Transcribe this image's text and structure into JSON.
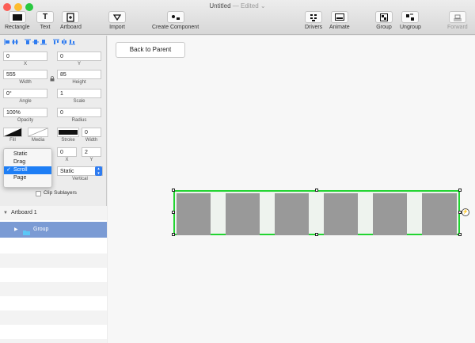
{
  "window": {
    "title": "Untitled",
    "edited": " — Edited ⌄"
  },
  "toolbar": {
    "rectangle": "Rectangle",
    "text": "Text",
    "artboard": "Artboard",
    "import": "Import",
    "create_component": "Create Component",
    "drivers": "Drivers",
    "animate": "Animate",
    "group": "Group",
    "ungroup": "Ungroup",
    "forward": "Forward",
    "text_icon_glyph": "T"
  },
  "inspector": {
    "x": {
      "value": "0",
      "label": "X"
    },
    "y": {
      "value": "0",
      "label": "Y"
    },
    "width": {
      "value": "555",
      "label": "Width"
    },
    "height": {
      "value": "85",
      "label": "Height"
    },
    "angle": {
      "value": "0°",
      "label": "Angle"
    },
    "scale": {
      "value": "1",
      "label": "Scale"
    },
    "opacity": {
      "value": "100%",
      "label": "Opacity"
    },
    "radius": {
      "value": "0",
      "label": "Radius"
    },
    "fill_label": "Fill",
    "media_label": "Media",
    "stroke_label": "Stroke",
    "stroke_width": {
      "value": "0",
      "label": "Width"
    },
    "scroll_x": {
      "value": "0",
      "label": "X"
    },
    "scroll_y": {
      "value": "2",
      "label": "Y"
    },
    "vertical_select": {
      "value": "Static",
      "label": "Vertical"
    },
    "clip_sublayers": "Clip Sublayers"
  },
  "dropdown": {
    "options": [
      "Static",
      "Drag",
      "Scroll",
      "Page"
    ],
    "selected": "Scroll",
    "check": "✓"
  },
  "layers": {
    "artboard": "Artboard 1",
    "group": "Group"
  },
  "canvas": {
    "back_button": "Back to Parent",
    "artboard_border_color": "#22d431"
  },
  "colors": {
    "accent": "#1e7ef5",
    "selected_layer": "#7b9bd4",
    "panel": "#999999"
  }
}
